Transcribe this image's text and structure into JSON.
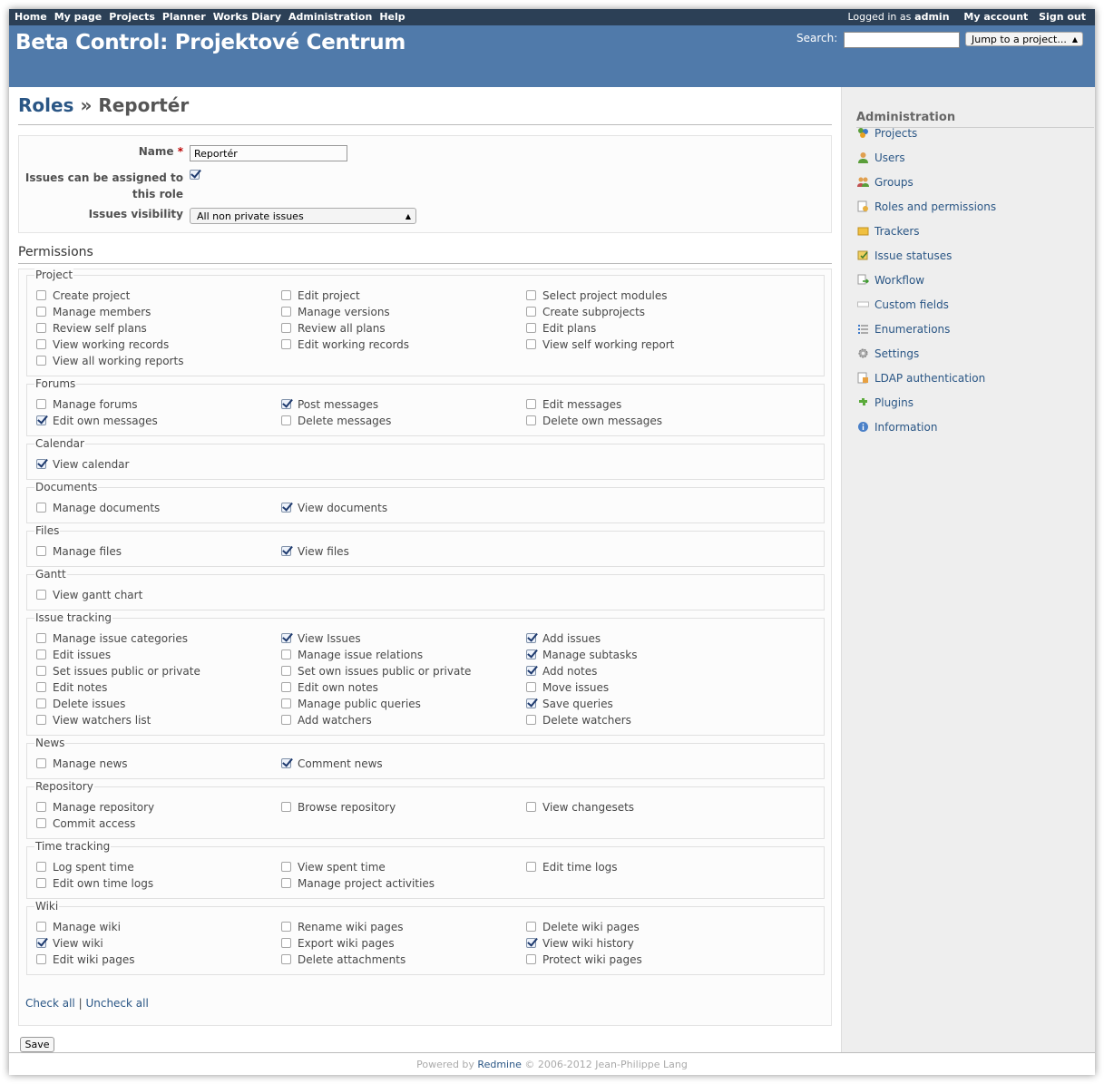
{
  "top_menu": {
    "items": [
      "Home",
      "My page",
      "Projects",
      "Planner",
      "Works Diary",
      "Administration",
      "Help"
    ],
    "logged_in_prefix": "Logged in as",
    "username": "admin",
    "my_account": "My account",
    "sign_out": "Sign out"
  },
  "header": {
    "title": "Beta Control: Projektové Centrum",
    "search_label": "Search:",
    "jump_label": "Jump to a project..."
  },
  "breadcrumb": {
    "parent": "Roles",
    "separator": "»",
    "current": "Reportér"
  },
  "role_form": {
    "name_label": "Name",
    "required_mark": "*",
    "name_value": "Reportér",
    "assignable_label_line1": "Issues can be assigned to",
    "assignable_label_line2": "this role",
    "assignable_checked": true,
    "visibility_label": "Issues visibility",
    "visibility_value": "All non private issues"
  },
  "permissions_title": "Permissions",
  "permission_groups": [
    {
      "name": "Project",
      "rows": 5,
      "items": [
        {
          "label": "Create project",
          "checked": false
        },
        {
          "label": "Edit project",
          "checked": false
        },
        {
          "label": "Select project modules",
          "checked": false
        },
        {
          "label": "Manage members",
          "checked": false
        },
        {
          "label": "Manage versions",
          "checked": false
        },
        {
          "label": "Create subprojects",
          "checked": false
        },
        {
          "label": "Review self plans",
          "checked": false
        },
        {
          "label": "Review all plans",
          "checked": false
        },
        {
          "label": "Edit plans",
          "checked": false
        },
        {
          "label": "View working records",
          "checked": false
        },
        {
          "label": "Edit working records",
          "checked": false
        },
        {
          "label": "View self working report",
          "checked": false
        },
        {
          "label": "View all working reports",
          "checked": false
        }
      ]
    },
    {
      "name": "Forums",
      "rows": 2,
      "items": [
        {
          "label": "Manage forums",
          "checked": false
        },
        {
          "label": "Post messages",
          "checked": true
        },
        {
          "label": "Edit messages",
          "checked": false
        },
        {
          "label": "Edit own messages",
          "checked": true
        },
        {
          "label": "Delete messages",
          "checked": false
        },
        {
          "label": "Delete own messages",
          "checked": false
        }
      ]
    },
    {
      "name": "Calendar",
      "rows": 1,
      "items": [
        {
          "label": "View calendar",
          "checked": true
        }
      ]
    },
    {
      "name": "Documents",
      "rows": 1,
      "items": [
        {
          "label": "Manage documents",
          "checked": false
        },
        {
          "label": "View documents",
          "checked": true
        }
      ]
    },
    {
      "name": "Files",
      "rows": 1,
      "items": [
        {
          "label": "Manage files",
          "checked": false
        },
        {
          "label": "View files",
          "checked": true
        }
      ]
    },
    {
      "name": "Gantt",
      "rows": 1,
      "items": [
        {
          "label": "View gantt chart",
          "checked": false
        }
      ]
    },
    {
      "name": "Issue tracking",
      "rows": 6,
      "items": [
        {
          "label": "Manage issue categories",
          "checked": false
        },
        {
          "label": "View Issues",
          "checked": true
        },
        {
          "label": "Add issues",
          "checked": true
        },
        {
          "label": "Edit issues",
          "checked": false
        },
        {
          "label": "Manage issue relations",
          "checked": false
        },
        {
          "label": "Manage subtasks",
          "checked": true
        },
        {
          "label": "Set issues public or private",
          "checked": false
        },
        {
          "label": "Set own issues public or private",
          "checked": false
        },
        {
          "label": "Add notes",
          "checked": true
        },
        {
          "label": "Edit notes",
          "checked": false
        },
        {
          "label": "Edit own notes",
          "checked": false
        },
        {
          "label": "Move issues",
          "checked": false
        },
        {
          "label": "Delete issues",
          "checked": false
        },
        {
          "label": "Manage public queries",
          "checked": false
        },
        {
          "label": "Save queries",
          "checked": true
        },
        {
          "label": "View watchers list",
          "checked": false
        },
        {
          "label": "Add watchers",
          "checked": false
        },
        {
          "label": "Delete watchers",
          "checked": false
        }
      ]
    },
    {
      "name": "News",
      "rows": 1,
      "items": [
        {
          "label": "Manage news",
          "checked": false
        },
        {
          "label": "Comment news",
          "checked": true
        }
      ]
    },
    {
      "name": "Repository",
      "rows": 2,
      "items": [
        {
          "label": "Manage repository",
          "checked": false
        },
        {
          "label": "Browse repository",
          "checked": false
        },
        {
          "label": "View changesets",
          "checked": false
        },
        {
          "label": "Commit access",
          "checked": false
        }
      ]
    },
    {
      "name": "Time tracking",
      "rows": 2,
      "items": [
        {
          "label": "Log spent time",
          "checked": false
        },
        {
          "label": "View spent time",
          "checked": false
        },
        {
          "label": "Edit time logs",
          "checked": false
        },
        {
          "label": "Edit own time logs",
          "checked": false
        },
        {
          "label": "Manage project activities",
          "checked": false
        }
      ]
    },
    {
      "name": "Wiki",
      "rows": 3,
      "items": [
        {
          "label": "Manage wiki",
          "checked": false
        },
        {
          "label": "Rename wiki pages",
          "checked": false
        },
        {
          "label": "Delete wiki pages",
          "checked": false
        },
        {
          "label": "View wiki",
          "checked": true
        },
        {
          "label": "Export wiki pages",
          "checked": false
        },
        {
          "label": "View wiki history",
          "checked": true
        },
        {
          "label": "Edit wiki pages",
          "checked": false
        },
        {
          "label": "Delete attachments",
          "checked": false
        },
        {
          "label": "Protect wiki pages",
          "checked": false
        }
      ]
    }
  ],
  "links": {
    "check_all": "Check all",
    "separator": "|",
    "uncheck_all": "Uncheck all"
  },
  "save_label": "Save",
  "sidebar": {
    "title": "Administration",
    "items": [
      {
        "label": "Projects",
        "icon": "projects-icon"
      },
      {
        "label": "Users",
        "icon": "user-icon"
      },
      {
        "label": "Groups",
        "icon": "group-icon"
      },
      {
        "label": "Roles and permissions",
        "icon": "roles-icon"
      },
      {
        "label": "Trackers",
        "icon": "tracker-icon"
      },
      {
        "label": "Issue statuses",
        "icon": "issue-status-icon"
      },
      {
        "label": "Workflow",
        "icon": "workflow-icon"
      },
      {
        "label": "Custom fields",
        "icon": "custom-fields-icon"
      },
      {
        "label": "Enumerations",
        "icon": "list-icon"
      },
      {
        "label": "Settings",
        "icon": "gear-icon"
      },
      {
        "label": "LDAP authentication",
        "icon": "ldap-icon"
      },
      {
        "label": "Plugins",
        "icon": "plugin-icon"
      },
      {
        "label": "Information",
        "icon": "info-icon"
      }
    ]
  },
  "footer": {
    "prefix": "Powered by",
    "link": "Redmine",
    "suffix": "© 2006-2012 Jean-Philippe Lang"
  }
}
